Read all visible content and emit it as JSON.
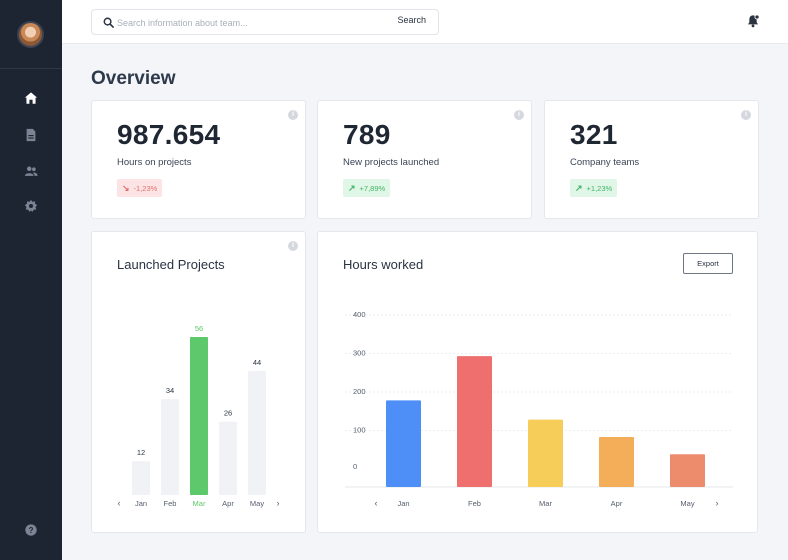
{
  "search": {
    "placeholder": "Search information about team...",
    "button_label": "Search"
  },
  "page_title": "Overview",
  "stats": [
    {
      "value": "987.654",
      "label": "Hours on projects",
      "change": "-1,23%",
      "direction": "down"
    },
    {
      "value": "789",
      "label": "New projects launched",
      "change": "+7,89%",
      "direction": "up"
    },
    {
      "value": "321",
      "label": "Company teams",
      "change": "+1,23%",
      "direction": "up"
    }
  ],
  "launched_card": {
    "title": "Launched Projects",
    "prev_label": "‹",
    "next_label": "›"
  },
  "hours_card": {
    "title": "Hours worked",
    "export_label": "Export",
    "prev_label": "‹",
    "next_label": "›"
  },
  "colors": {
    "sidebar": "#1d2532",
    "highlight_green": "#5ec86c",
    "bar_grey": "#f1f2f5"
  },
  "chart_data": [
    {
      "type": "bar",
      "title": "Launched Projects",
      "categories": [
        "Jan",
        "Feb",
        "Mar",
        "Apr",
        "May"
      ],
      "values": [
        12,
        34,
        56,
        26,
        44
      ],
      "highlight_index": 2,
      "ylim": [
        0,
        56
      ]
    },
    {
      "type": "bar",
      "title": "Hours worked",
      "categories": [
        "Jan",
        "Feb",
        "Mar",
        "Apr",
        "May"
      ],
      "values": [
        225,
        340,
        175,
        130,
        85
      ],
      "bar_colors": [
        "#4e8ef7",
        "#ef6e6e",
        "#f7cd5a",
        "#f4ad58",
        "#ec8c6c"
      ],
      "y_ticks": [
        "400",
        "300",
        "200",
        "100",
        "0"
      ],
      "grid": true
    }
  ]
}
